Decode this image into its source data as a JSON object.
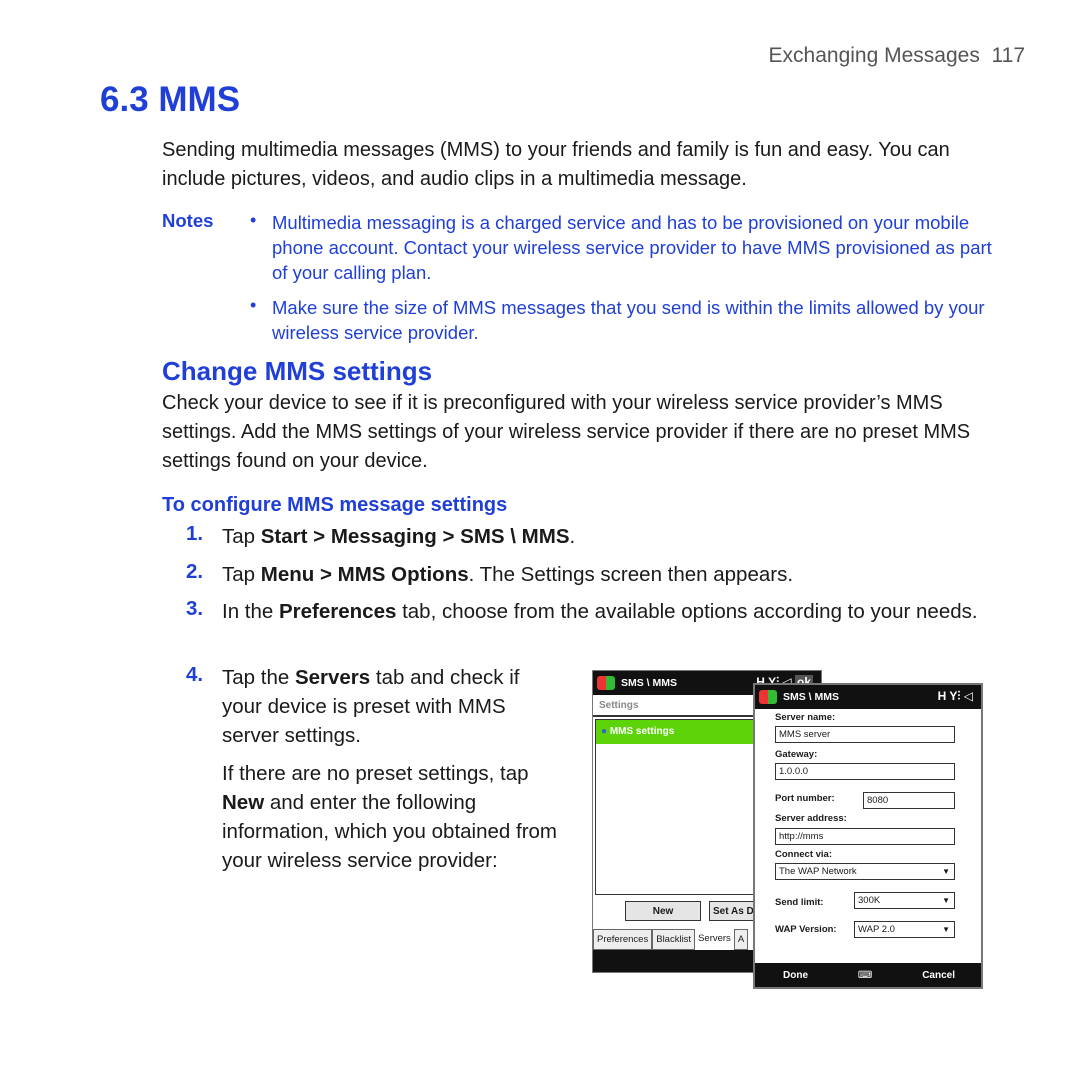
{
  "header": {
    "chapter": "Exchanging Messages",
    "page": "117"
  },
  "section_title": "6.3 MMS",
  "intro": "Sending multimedia messages (MMS) to your friends and family is fun and easy. You can include pictures, videos, and audio clips in a multimedia message.",
  "notes": {
    "label": "Notes",
    "items": [
      "Multimedia messaging is a charged service and has to be provisioned on your mobile phone account. Contact your wireless service provider to have MMS provisioned as part of your calling plan.",
      "Make sure the size of MMS messages that you send is within the limits allowed by your wireless service provider."
    ]
  },
  "subsection_title": "Change MMS settings",
  "sub_intro": "Check your device to see if it is preconfigured with your wireless service provider’s MMS settings. Add the MMS settings of your wireless service provider if there are no preset MMS settings found on your device.",
  "procedure_title": "To configure MMS message settings",
  "steps": [
    {
      "num": "1.",
      "a": "Tap ",
      "b1": "Start",
      "c": " > ",
      "b2": "Messaging",
      "d": " > ",
      "b3": "SMS \\ MMS",
      "e": "."
    },
    {
      "num": "2.",
      "a": "Tap ",
      "b1": "Menu",
      "c": " > ",
      "b2": "MMS Options",
      "d": ". The Settings screen then appears."
    },
    {
      "num": "3.",
      "a": "In the ",
      "b1": "Preferences",
      "c": " tab, choose from the available options according to your needs."
    },
    {
      "num": "4.",
      "a": "Tap the ",
      "b1": "Servers",
      "c": " tab and check if your device is preset with MMS server settings.",
      "p2a": "If there are no preset settings, tap ",
      "p2b": "New",
      "p2c": " and enter the following information, which you obtained from your wireless service provider:"
    }
  ],
  "back_screen": {
    "title": "SMS \\ MMS",
    "ok": "ok",
    "header": "Settings",
    "item": "MMS settings",
    "buttons": [
      "New",
      "Set As D"
    ],
    "tabs": [
      "Preferences",
      "Blacklist",
      "Servers",
      "A"
    ]
  },
  "front_screen": {
    "title": "SMS \\ MMS",
    "fields": [
      {
        "label": "Server name:",
        "value": "MMS server"
      },
      {
        "label": "Gateway:",
        "value": "1.0.0.0"
      },
      {
        "label": "Port number:",
        "value": "8080"
      },
      {
        "label": "Server address:",
        "value": "http://mms"
      },
      {
        "label": "Connect via:",
        "value": "The WAP Network"
      },
      {
        "label": "Send limit:",
        "value": "300K"
      },
      {
        "label": "WAP Version:",
        "value": "WAP 2.0"
      }
    ],
    "done": "Done",
    "cancel": "Cancel"
  },
  "colors": {
    "accent": "#1f3fd6",
    "highlight": "#5dd40a"
  }
}
